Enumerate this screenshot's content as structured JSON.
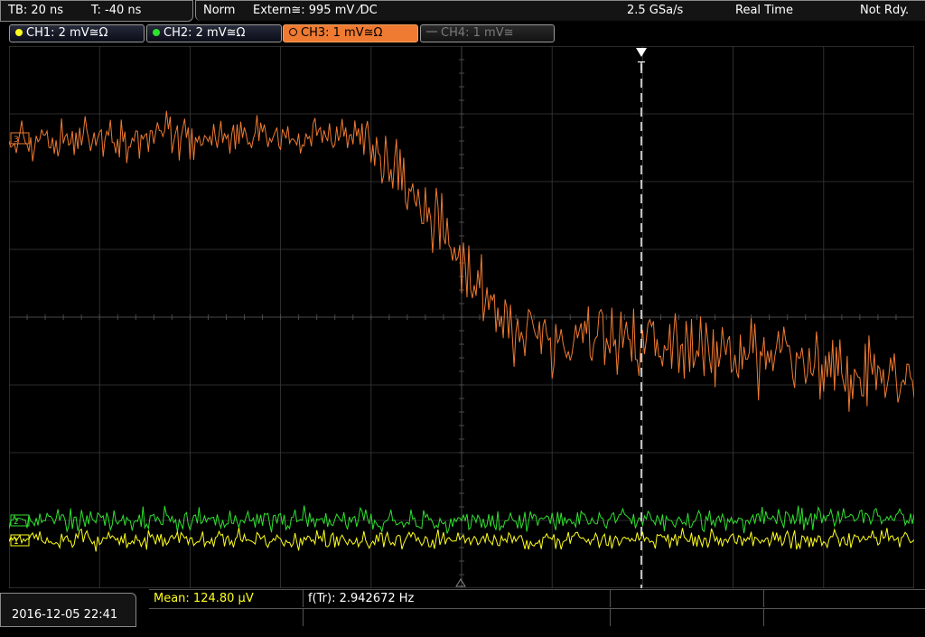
{
  "timebase": {
    "tb": "TB: 20 ns",
    "t": "T: -40 ns"
  },
  "trigger": {
    "mode": "Norm",
    "source": "Extern≅: 995 mV ⁄DC",
    "sample_rate": "2.5 GSa/s",
    "acq": "Real Time",
    "status": "Not Rdy."
  },
  "channels": [
    {
      "label": "CH1: 2 mV≅Ω",
      "color": "#ffff1e",
      "state": "on"
    },
    {
      "label": "CH2: 2 mV≅Ω",
      "color": "#2fe02f",
      "state": "on"
    },
    {
      "label": "CH3: 1 mV≅Ω",
      "color": "#ef7a31",
      "state": "active"
    },
    {
      "label": "CH4: 1 mV≅",
      "color": "#7a7a7a",
      "state": "off"
    }
  ],
  "trigger_marker": "T",
  "measurements": {
    "mean": "Mean: 124.80 µV",
    "freq": "f(Tr): 2.942672 Hz"
  },
  "datetime": "2016-12-05 22:41",
  "colors": {
    "grid": "#3a3a3a",
    "ch3": "#ef7a31",
    "ch2": "#2fe02f",
    "ch1": "#ffff1e",
    "trigger_line": "#ffffff"
  }
}
